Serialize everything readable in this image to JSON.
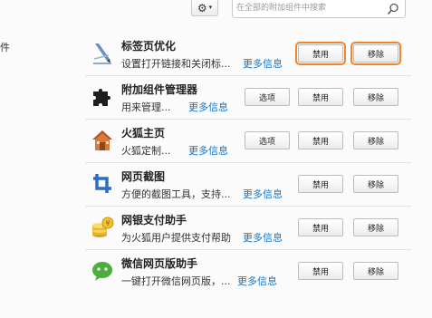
{
  "toolbar": {
    "search_placeholder": "在全部的附加组件中搜索"
  },
  "sidebar": {
    "label": "件"
  },
  "addons": [
    {
      "name": "标签页优化",
      "desc": "设置打开链接和关闭标...",
      "more": "更多信息",
      "options": "",
      "disable": "禁用",
      "remove": "移除",
      "icon": "pen-icon",
      "highlighted": true
    },
    {
      "name": "附加组件管理器",
      "desc": "用来管理...",
      "more": "更多信息",
      "options": "选项",
      "disable": "禁用",
      "remove": "移除",
      "icon": "puzzle-icon"
    },
    {
      "name": "火狐主页",
      "desc": "火狐定制...",
      "more": "更多信息",
      "options": "选项",
      "disable": "禁用",
      "remove": "移除",
      "icon": "house-icon"
    },
    {
      "name": "网页截图",
      "desc": "方便的截图工具，支持...",
      "more": "更多信息",
      "options": "",
      "disable": "禁用",
      "remove": "移除",
      "icon": "crop-icon"
    },
    {
      "name": "网银支付助手",
      "desc": "为火狐用户提供支付帮助",
      "more": "更多信息",
      "options": "",
      "disable": "禁用",
      "remove": "移除",
      "icon": "coins-icon"
    },
    {
      "name": "微信网页版助手",
      "desc": "一键打开微信网页版，...",
      "more": "更多信息",
      "options": "",
      "disable": "禁用",
      "remove": "移除",
      "icon": "wechat-icon"
    }
  ]
}
